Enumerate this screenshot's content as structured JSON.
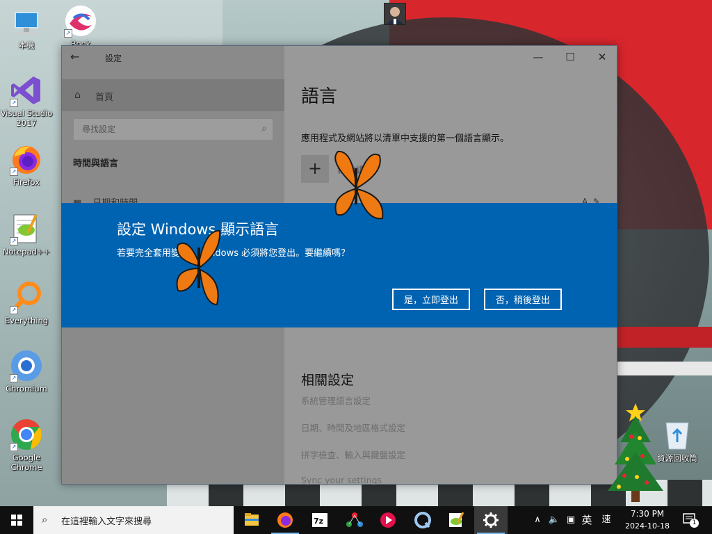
{
  "desktop": {
    "icons": [
      {
        "label": "本機"
      },
      {
        "label": "Visual Studio 2017"
      },
      {
        "label": "Firefox"
      },
      {
        "label": "Notepad++"
      },
      {
        "label": "Everything"
      },
      {
        "label": "Chromium"
      },
      {
        "label": "Google Chrome"
      },
      {
        "label": "資源回收筒"
      }
    ],
    "partial_label": "Book"
  },
  "settings": {
    "window_title": "設定",
    "back_icon": "←",
    "minimize_icon": "—",
    "maximize_icon": "☐",
    "close_icon": "✕",
    "sidebar": {
      "home_label": "首頁",
      "search_placeholder": "尋找設定",
      "section_header": "時間與語言",
      "nav_date": "日期和時間"
    },
    "main": {
      "page_title": "語言",
      "description": "應用程式及網站將以清單中支援的第一個語言顯示。",
      "add_language": "新增語言",
      "related_title": "相關設定",
      "related_links": [
        "系統管理語言設定",
        "日期、時間及地區格式設定",
        "拼字檢查、輸入與鍵盤設定",
        "Sync your settings"
      ]
    }
  },
  "dialog": {
    "title": "設定 Windows 顯示語言",
    "message": "若要完全套用變更，Windows 必須將您登出。要繼續嗎？",
    "yes_button": "是，立即登出",
    "no_button": "否，稍後登出"
  },
  "taskbar": {
    "search_placeholder": "在這裡輸入文字來搜尋",
    "ime_mode": "英",
    "ime_layout": "速",
    "time": "7:30 PM",
    "date": "2024-10-18",
    "notification_count": "1",
    "tray_chevron": "∧"
  },
  "colors": {
    "dialog_bg": "#0063b1",
    "taskbar_bg": "#101010",
    "accent": "#76b9ed"
  }
}
